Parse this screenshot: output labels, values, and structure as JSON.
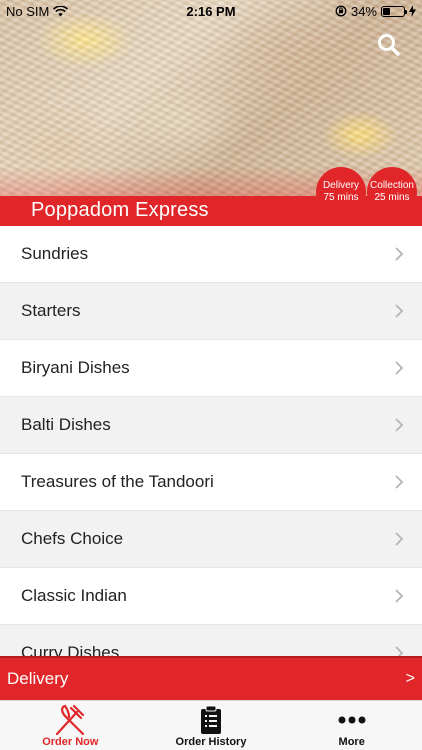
{
  "status_bar": {
    "carrier": "No SIM",
    "time": "2:16 PM",
    "battery": "34%",
    "battery_level": 0.34
  },
  "header": {
    "restaurant_name": "Poppadom Express",
    "search_icon": "search-icon",
    "delivery_badge": {
      "label": "Delivery",
      "time": "75 mins"
    },
    "collection_badge": {
      "label": "Collection",
      "time": "25 mins"
    }
  },
  "categories": [
    {
      "label": "Sundries"
    },
    {
      "label": "Starters"
    },
    {
      "label": "Biryani Dishes"
    },
    {
      "label": "Balti Dishes"
    },
    {
      "label": "Treasures of the Tandoori"
    },
    {
      "label": "Chefs Choice"
    },
    {
      "label": "Classic Indian"
    },
    {
      "label": "Curry Dishes"
    }
  ],
  "delivery_bar": {
    "label": "Delivery",
    "arrow": ">"
  },
  "tabs": [
    {
      "label": "Order Now",
      "icon": "fork-knife-icon",
      "active": true
    },
    {
      "label": "Order History",
      "icon": "clipboard-list-icon",
      "active": false
    },
    {
      "label": "More",
      "icon": "more-dots-icon",
      "active": false
    }
  ],
  "colors": {
    "brand_red": "#e12629",
    "row_alt": "#f2f2f2"
  }
}
